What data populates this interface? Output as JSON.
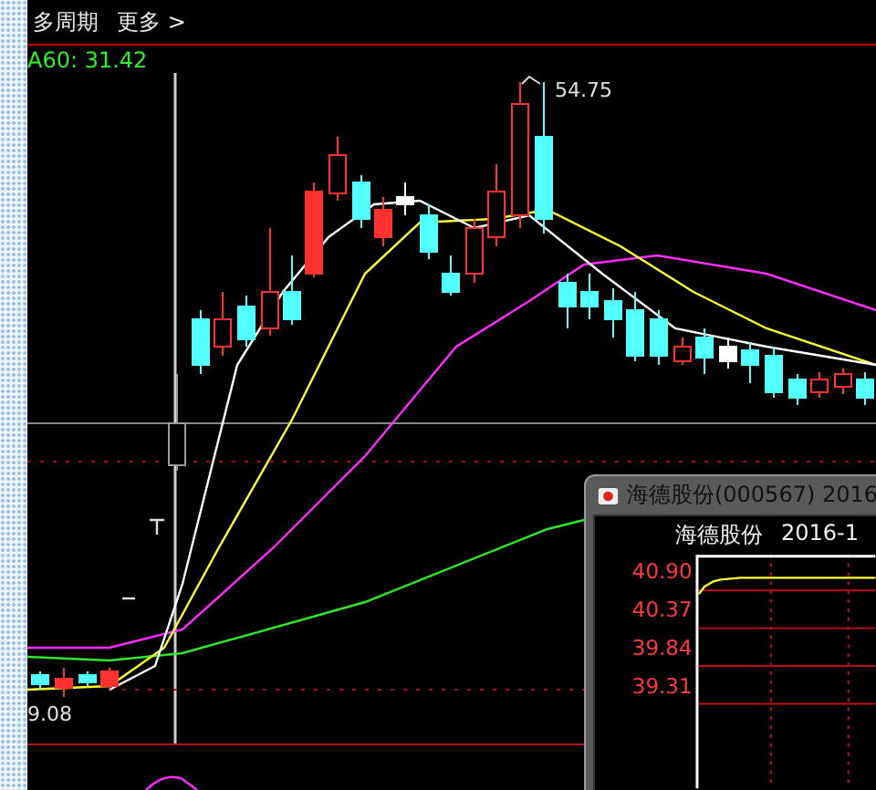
{
  "toolbar": {
    "items": [
      "多周期",
      "更多 >"
    ]
  },
  "indicator": {
    "label": "A60: 31.42"
  },
  "chart": {
    "high_label": "54.75",
    "low_label": "9.08"
  },
  "popup": {
    "title": "海德股份(000567) 2016",
    "header_name": "海德股份",
    "header_date": "2016-1",
    "price_ticks": [
      "40.90",
      "40.37",
      "39.84",
      "39.31"
    ]
  }
}
